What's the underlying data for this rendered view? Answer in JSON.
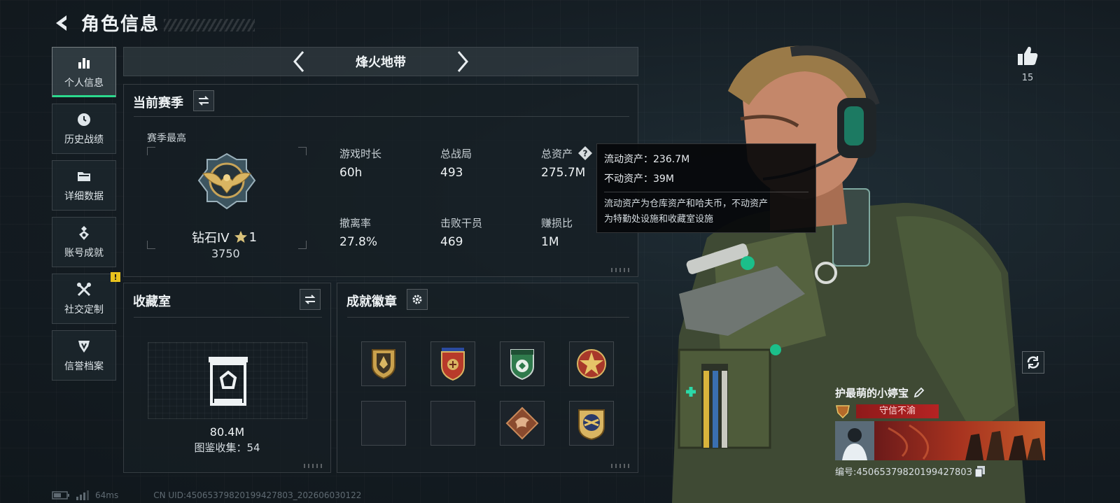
{
  "header": {
    "title": "角色信息"
  },
  "sidebar": {
    "items": [
      {
        "label": "个人信息",
        "icon": "bar-chart-icon",
        "active": true
      },
      {
        "label": "历史战绩",
        "icon": "clock-history-icon"
      },
      {
        "label": "详细数据",
        "icon": "folder-icon"
      },
      {
        "label": "账号成就",
        "icon": "medal-icon"
      },
      {
        "label": "社交定制",
        "icon": "tools-icon",
        "badge": "!"
      },
      {
        "label": "信誉档案",
        "icon": "shield-icon"
      }
    ]
  },
  "mode_selector": {
    "current": "烽火地带"
  },
  "season": {
    "title": "当前赛季",
    "best_label": "赛季最高",
    "rank_name": "钻石IV",
    "rank_stars": "1",
    "rank_score": "3750",
    "stats": [
      {
        "label": "游戏时长",
        "value": "60h"
      },
      {
        "label": "总战局",
        "value": "493"
      },
      {
        "label": "总资产",
        "value": "275.7M"
      },
      {
        "label": "撤离率",
        "value": "27.8%"
      },
      {
        "label": "击败干员",
        "value": "469"
      },
      {
        "label": "赚损比",
        "value": "1M"
      }
    ]
  },
  "tooltip": {
    "liquid": "流动资产：236.7M",
    "fixed": "不动资产：39M",
    "desc_line1": "流动资产为仓库资产和哈夫币，不动资产",
    "desc_line2": "为特勤处设施和收藏室设施"
  },
  "collection": {
    "title": "收藏室",
    "value": "80.4M",
    "catalog": "图鉴收集：54"
  },
  "achievements": {
    "title": "成就徽章",
    "badges": [
      "gold-shield-badge",
      "red-gold-badge",
      "green-shield-badge",
      "star-badge",
      "",
      "",
      "dragon-diamond-badge",
      "round-gold-badge"
    ]
  },
  "player": {
    "likes": "15",
    "name": "护最萌的小婷宝",
    "title_tag": "守信不渝",
    "uid": "编号:4506537982019942780З"
  },
  "footer": {
    "ping": "64ms",
    "uid_line": "CN UID:4506537982019942780З_202606030122"
  },
  "colors": {
    "accent": "#2bd98d",
    "warn": "#e8c21e",
    "title_red": "#b52323"
  }
}
